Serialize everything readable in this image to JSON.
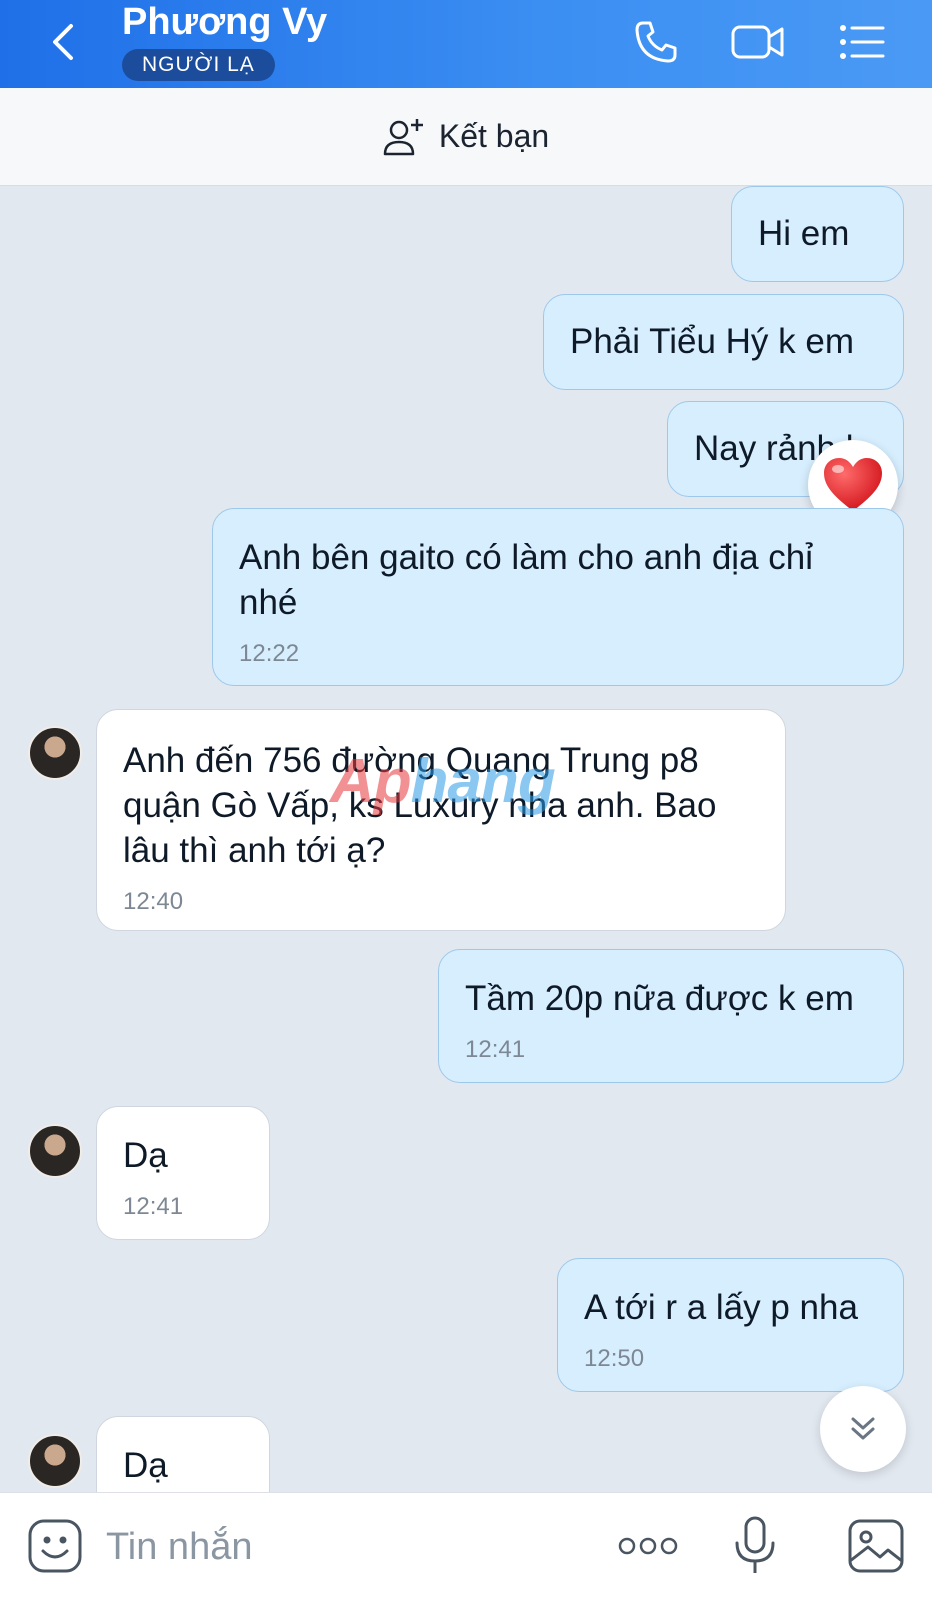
{
  "header": {
    "contact_name": "Phương Vy",
    "badge": "NGƯỜI LẠ",
    "icons": [
      "back-chevron-icon",
      "phone-call-icon",
      "video-call-icon",
      "menu-list-icon"
    ]
  },
  "friend_bar": {
    "label": "Kết bạn",
    "icon": "add-friend-icon"
  },
  "messages": [
    {
      "from": "me",
      "text": "Hi em"
    },
    {
      "from": "me",
      "text": "Phải Tiểu Hý k em"
    },
    {
      "from": "me",
      "text": "Nay rảnh k",
      "reaction": "heart-emoji"
    },
    {
      "from": "me",
      "text": "Anh bên gaito có làm cho anh địa chỉ nhé",
      "time": "12:22"
    },
    {
      "from": "them",
      "text": "Anh đến 756 đường Quang Trung p8 quận Gò Vấp, ks Luxury nha anh. Bao lâu thì anh tới ạ?",
      "time": "12:40"
    },
    {
      "from": "me",
      "text": "Tầm 20p nữa được k em",
      "time": "12:41"
    },
    {
      "from": "them",
      "text": "Dạ",
      "time": "12:41"
    },
    {
      "from": "me",
      "text": "A tới r a lấy p nha",
      "time": "12:50"
    },
    {
      "from": "them",
      "text": "Dạ"
    }
  ],
  "watermark": {
    "part1": "Ap",
    "part2": "hang"
  },
  "composer": {
    "placeholder": "Tin nhắn",
    "icons": [
      "sticker-emoji-icon",
      "more-options-icon",
      "microphone-icon",
      "image-gallery-icon"
    ]
  },
  "colors": {
    "header_start": "#1f6fe8",
    "header_end": "#4a9af5",
    "my_bubble": "#d6eefe",
    "their_bubble": "#ffffff",
    "chat_bg": "#e2e8f0",
    "badge_bg": "#1c4d9c"
  }
}
